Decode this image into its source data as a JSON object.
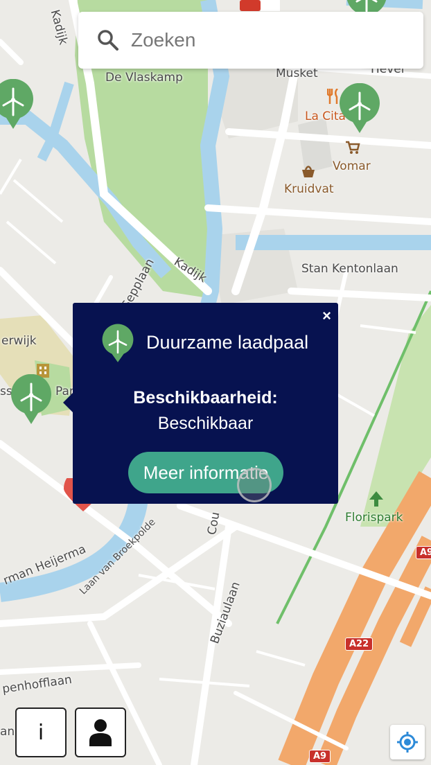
{
  "search": {
    "placeholder": "Zoeken"
  },
  "map": {
    "street_labels": [
      "Kadijk",
      "De Vlaskamp",
      "Musket",
      "Hevel",
      "Stan Kentonlaan",
      "Kadijk",
      "Sepplaan",
      "erwijk",
      "ss",
      "Pan",
      "rman Heijerma",
      "Laan van Broekpolde",
      "Cou",
      "Buziaulaan",
      "penhofflaan",
      "an"
    ],
    "poi_labels": [
      "La Cita",
      "Vomar",
      "Kruidvat",
      "Florispark"
    ],
    "road_shields": [
      "A9",
      "A22",
      "A9"
    ]
  },
  "popup": {
    "title": "Duurzame laadpaal",
    "availability_label": "Beschikbaarheid:",
    "availability_value": "Beschikbaar",
    "more_info_button": "Meer informatie",
    "close_glyph": "×"
  },
  "controls": {
    "info_button": "i",
    "profile_icon": "person-icon",
    "locate_icon": "locate-icon"
  },
  "colors": {
    "popup_bg": "#071250",
    "button_bg": "#3fa58b",
    "marker_green": "#5fa865",
    "water": "#a9d3ec",
    "park": "#b7dba0",
    "highway": "#f2a86b"
  }
}
